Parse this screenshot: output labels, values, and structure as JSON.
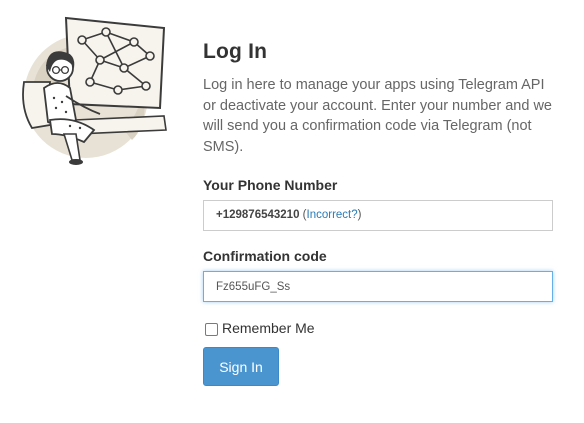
{
  "login": {
    "title": "Log In",
    "description": "Log in here to manage your apps using Telegram API or deactivate your account. Enter your number and we will send you a confirmation code via Telegram (not SMS).",
    "phone_label": "Your Phone Number",
    "phone_number": "+129876543210",
    "phone_open_paren": " (",
    "incorrect_link": "Incorrect?",
    "phone_close_paren": ")",
    "code_label": "Confirmation code",
    "code_value": "Fz655uFG_Ss",
    "remember_label": "Remember Me",
    "remember_checked": false,
    "sign_in_label": "Sign In"
  },
  "colors": {
    "accent": "#4a95d0",
    "link": "#2a7bb5",
    "focus_border": "#66afe9"
  },
  "icons": {
    "illustration": "telegram-user-illustration"
  }
}
